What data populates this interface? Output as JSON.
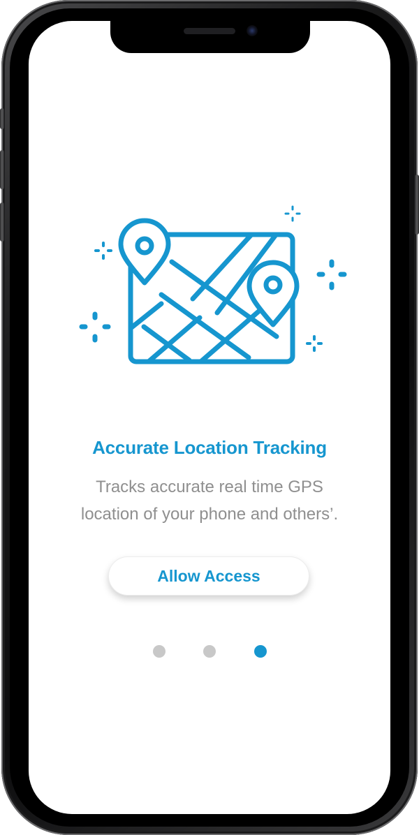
{
  "onboarding": {
    "title": "Accurate Location Tracking",
    "description_line1": "Tracks accurate real time GPS",
    "description_line2": "location of your phone and others’.",
    "button_label": "Allow Access",
    "page_count": 3,
    "active_page": 3
  },
  "illustration": {
    "name": "map-with-location-pins-icon"
  },
  "colors": {
    "accent": "#1696cf",
    "text_secondary": "#8f8f8f",
    "dot_inactive": "#c8c8c8",
    "dot_active": "#1696cf",
    "screen_background": "#ffffff"
  }
}
